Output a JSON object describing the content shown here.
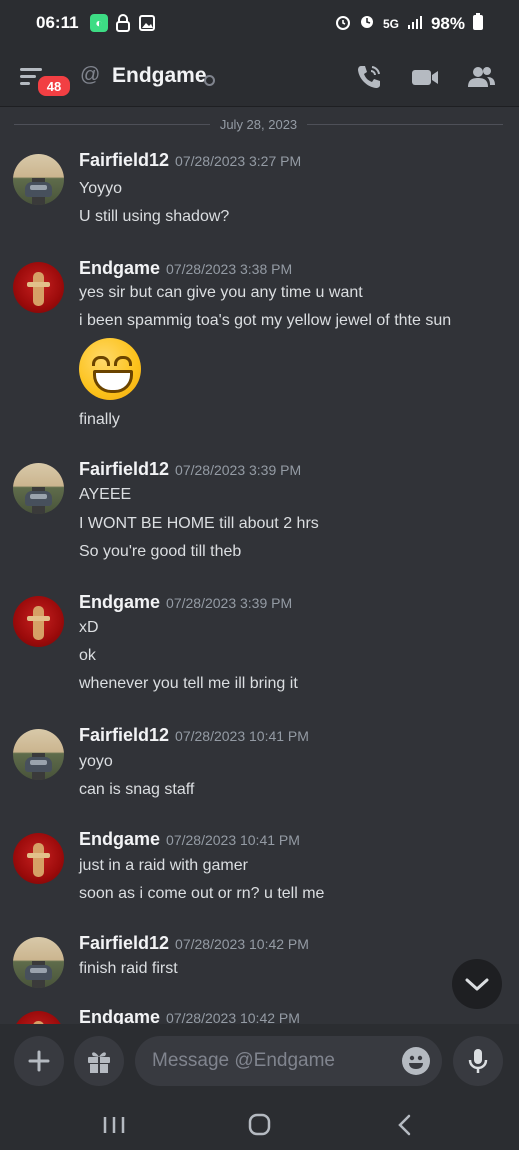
{
  "status_bar": {
    "time": "06:11",
    "network": "5G",
    "battery": "98%"
  },
  "header": {
    "unread_count": "48",
    "channel_name": "Endgame"
  },
  "date_divider": "July 28, 2023",
  "messages": [
    {
      "author": "Fairfield12",
      "timestamp": "07/28/2023 3:27 PM",
      "avatar": "road-car-avatar",
      "lines": [
        "Yoyyo",
        "U still using shadow?"
      ]
    },
    {
      "author": "Endgame",
      "timestamp": "07/28/2023 3:38 PM",
      "avatar": "red-figure-avatar",
      "lines": [
        "yes sir but can give you any time u want",
        "i been spammig toa's got my yellow jewel of thte sun",
        "finally"
      ]
    },
    {
      "author": "Fairfield12",
      "timestamp": "07/28/2023 3:39 PM",
      "avatar": "road-car-avatar",
      "lines": [
        "AYEEE",
        "I WONT BE HOME till about 2 hrs",
        "So you're good till theb"
      ]
    },
    {
      "author": "Endgame",
      "timestamp": "07/28/2023 3:39 PM",
      "avatar": "red-figure-avatar",
      "lines": [
        "xD",
        "ok",
        "whenever you tell me ill bring it"
      ]
    },
    {
      "author": "Fairfield12",
      "timestamp": "07/28/2023 10:41 PM",
      "avatar": "road-car-avatar",
      "lines": [
        "yoyo",
        "can is snag staff"
      ]
    },
    {
      "author": "Endgame",
      "timestamp": "07/28/2023 10:41 PM",
      "avatar": "red-figure-avatar",
      "lines": [
        "just in a raid with gamer",
        "soon as i come out or rn? u tell me"
      ]
    },
    {
      "author": "Fairfield12",
      "timestamp": "07/28/2023 10:42 PM",
      "avatar": "road-car-avatar",
      "lines": [
        "finish raid first"
      ]
    },
    {
      "author": "Endgame",
      "timestamp": "07/28/2023 10:42 PM",
      "avatar": "red-figure-avatar",
      "lines": []
    }
  ],
  "composer": {
    "placeholder": "Message @Endgame"
  },
  "colors": {
    "background": "#313338",
    "header": "#2b2d31",
    "badge": "#f23f43",
    "text": "#dbdee1",
    "muted": "#949ba4"
  },
  "icons": [
    "menu-icon",
    "at-icon",
    "call-icon",
    "video-icon",
    "members-icon",
    "chevron-down-icon",
    "plus-icon",
    "gift-icon",
    "emoji-icon",
    "microphone-icon",
    "recents-icon",
    "home-icon",
    "back-icon"
  ]
}
